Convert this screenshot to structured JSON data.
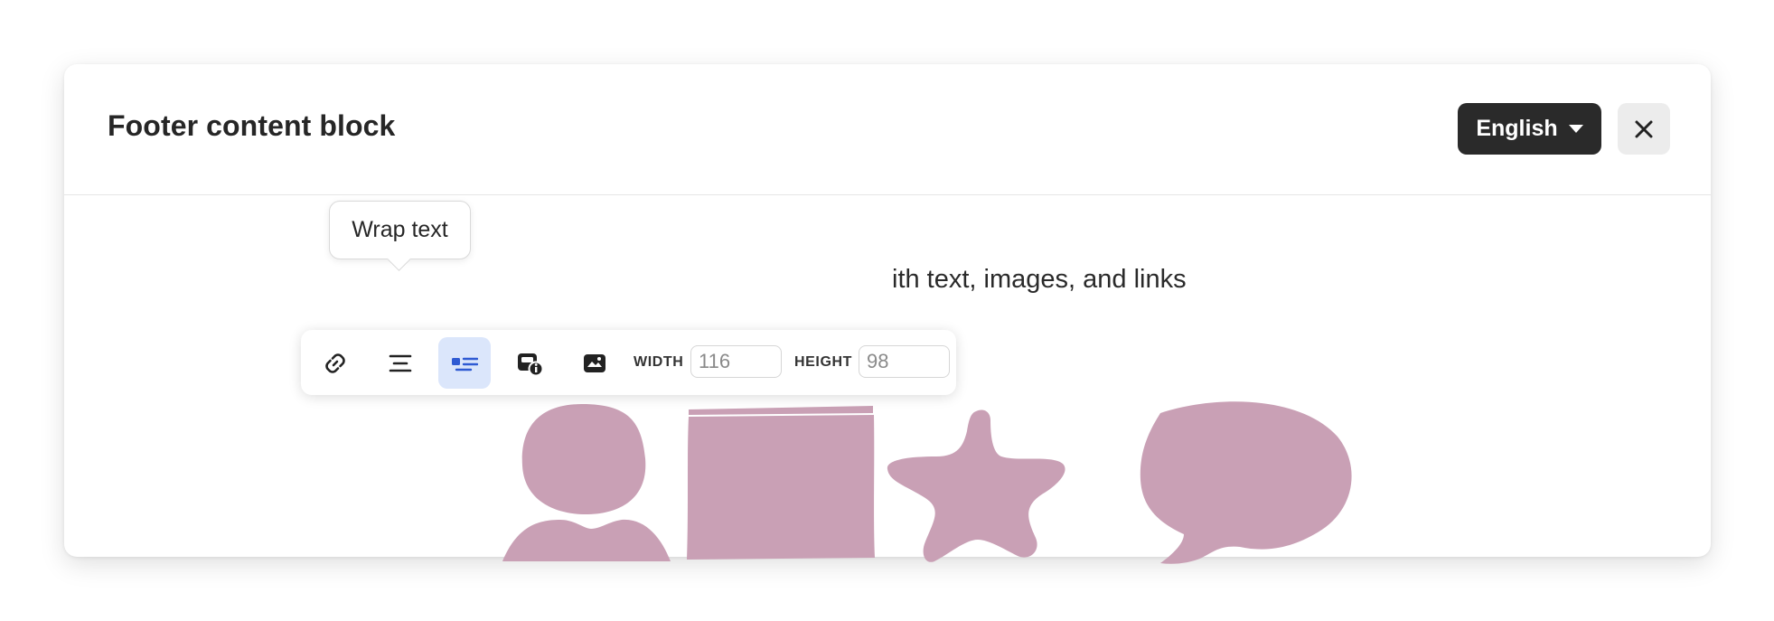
{
  "dialog": {
    "title": "Footer content block",
    "language_label": "English",
    "body_text": "ith text, images, and links"
  },
  "toolbar": {
    "buttons": [
      "link-icon",
      "align-center-icon",
      "wrap-text-icon",
      "image-info-icon",
      "image-icon"
    ],
    "width_label": "WIDTH",
    "width_placeholder": "116",
    "height_label": "HEIGHT",
    "height_placeholder": "98"
  },
  "tooltip": {
    "text": "Wrap text"
  },
  "colors": {
    "accent_active": "#dbe6fb",
    "icon_active": "#2f5bd3",
    "illustration": "#c9a0b5",
    "dark_button": "#2a2a2a"
  }
}
